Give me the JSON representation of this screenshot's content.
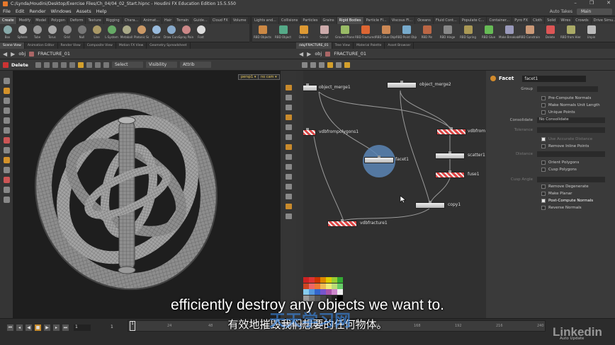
{
  "window": {
    "title": "C:/Lynda/Houdini/Desktop/Exercise Files/Ch_04/04_02_Start.hipnc - Houdini FX Education Edition 15.5.550",
    "controls": [
      "–",
      "❐",
      "✕"
    ]
  },
  "menu": {
    "items": [
      "File",
      "Edit",
      "Render",
      "Windows",
      "Assets",
      "Help"
    ],
    "auto_takes": "Auto Takes",
    "desktop": "Main"
  },
  "shelf_left": {
    "tabs": [
      "Create",
      "Modify",
      "Model",
      "Polygon",
      "Deform",
      "Texture",
      "Rigging",
      "Chara...",
      "Animat...",
      "Hair",
      "Terrain",
      "Guide...",
      "Cloud FX",
      "Volume"
    ],
    "tools": [
      "Box",
      "Sphere",
      "Tube",
      "Torus",
      "Grid",
      "Null",
      "Line",
      "L-System",
      "Metaball",
      "Platonic Sol.",
      "Curve",
      "Draw Curve",
      "Spray Paint",
      "Font"
    ]
  },
  "shelf_right": {
    "tabs": [
      "Lights and...",
      "Collisions",
      "Particles",
      "Grains",
      "Rigid Bodies",
      "Particle Fl...",
      "Viscous Fl...",
      "Oceans",
      "Fluid Cont...",
      "Populate C...",
      "Container...",
      "Pyro FX",
      "Cloth",
      "Solid",
      "Wires",
      "Crowds",
      "Drive Simu..."
    ],
    "active_tab": "Rigid Bodies",
    "tools": [
      "RBD Objects",
      "RBD Object",
      "Debris",
      "Sculpt",
      "Ground Plane",
      "RBD Fractured",
      "RBD Glue Object",
      "RBD Point Object",
      "RBD Pin",
      "RBD Hinge",
      "RBD Spring",
      "RBD Glue",
      "Make Breakable",
      "RBD Constraints",
      "Delete",
      "RBD from Hierarchy",
      "Unpin"
    ]
  },
  "left_pane": {
    "tabs": [
      "Scene View",
      "Animation Editor",
      "Render View",
      "Composite View",
      "Motion FX View",
      "Geometry Spreadsheet"
    ],
    "path": [
      "obj",
      "FRACTURE_01"
    ],
    "tool_label": "Delete",
    "select_mode": "Select",
    "visibility": "Visibility",
    "attrib": "Attrib",
    "persp": "persp1 ▾",
    "cam": "no cam ▾"
  },
  "network_pane": {
    "tabs": [
      "/obj/FRACTURE_01",
      "Tree View",
      "Material Palette",
      "Asset Browser"
    ],
    "path": [
      "obj",
      "FRACTURE_01"
    ],
    "nodes": [
      {
        "name": "object_merge1",
        "red": false
      },
      {
        "name": "object_merge2",
        "red": false
      },
      {
        "name": "vdbfrompolygons1",
        "red": true
      },
      {
        "name": "vdbfrom",
        "red": true
      },
      {
        "name": "facet1",
        "red": false
      },
      {
        "name": "scatter1",
        "red": false
      },
      {
        "name": "fuse1",
        "red": true
      },
      {
        "name": "copy1",
        "red": false
      },
      {
        "name": "vdbfracture1",
        "red": true
      }
    ],
    "palette": [
      "#cc2222",
      "#dd3333",
      "#cc3300",
      "#dd8800",
      "#ddcc00",
      "#99cc33",
      "#33aa33",
      "#cc4422",
      "#ee6666",
      "#ee7733",
      "#eebb55",
      "#eeee77",
      "#bbdd77",
      "#66cc66",
      "#88ccee",
      "#5599dd",
      "#3366cc",
      "#7755cc",
      "#aa55aa",
      "#cc88cc",
      "#eeeeee",
      "#999999",
      "#777777",
      "#555555",
      "#444444",
      "#333333",
      "#222222",
      "#000000"
    ]
  },
  "params": {
    "node_type": "Facet",
    "node_name": "facet1",
    "group_label": "Group",
    "consolidate_label": "Consolidate",
    "consolidate_value": "No Consolidate",
    "tolerance_label": "Tolerance",
    "distance_label": "Distance",
    "cusp_angle_label": "Cusp Angle",
    "rows": [
      {
        "label": "Pre-Compute Normals",
        "checked": false,
        "dim": false
      },
      {
        "label": "Make Normals Unit Length",
        "checked": false,
        "dim": false
      },
      {
        "label": "Unique Points",
        "checked": false,
        "dim": false
      },
      {
        "label": "Use Accurate Distance",
        "checked": true,
        "dim": true
      },
      {
        "label": "Remove Inline Points",
        "checked": false,
        "dim": false
      },
      {
        "label": "Orient Polygons",
        "checked": false,
        "dim": false
      },
      {
        "label": "Cusp Polygons",
        "checked": false,
        "dim": false
      },
      {
        "label": "Remove Degenerate",
        "checked": false,
        "dim": false
      },
      {
        "label": "Make Planar",
        "checked": false,
        "dim": false
      },
      {
        "label": "Post-Compute Normals",
        "checked": true,
        "dim": false
      },
      {
        "label": "Reverse Normals",
        "checked": false,
        "dim": false
      }
    ]
  },
  "timeline": {
    "frame": "1",
    "start": "1",
    "ticks": [
      "24",
      "48",
      "72",
      "96",
      "120",
      "144",
      "168",
      "192",
      "216",
      "240"
    ],
    "auto_update": "Auto Update"
  },
  "subtitles": {
    "english": "efficiently destroy any objects we want to.",
    "chinese": "有效地摧毁我们想要的任何物体。"
  },
  "watermark": {
    "site": "天天学习网",
    "url": "ttoxiaoshi.com"
  },
  "brand": "Linkedin"
}
